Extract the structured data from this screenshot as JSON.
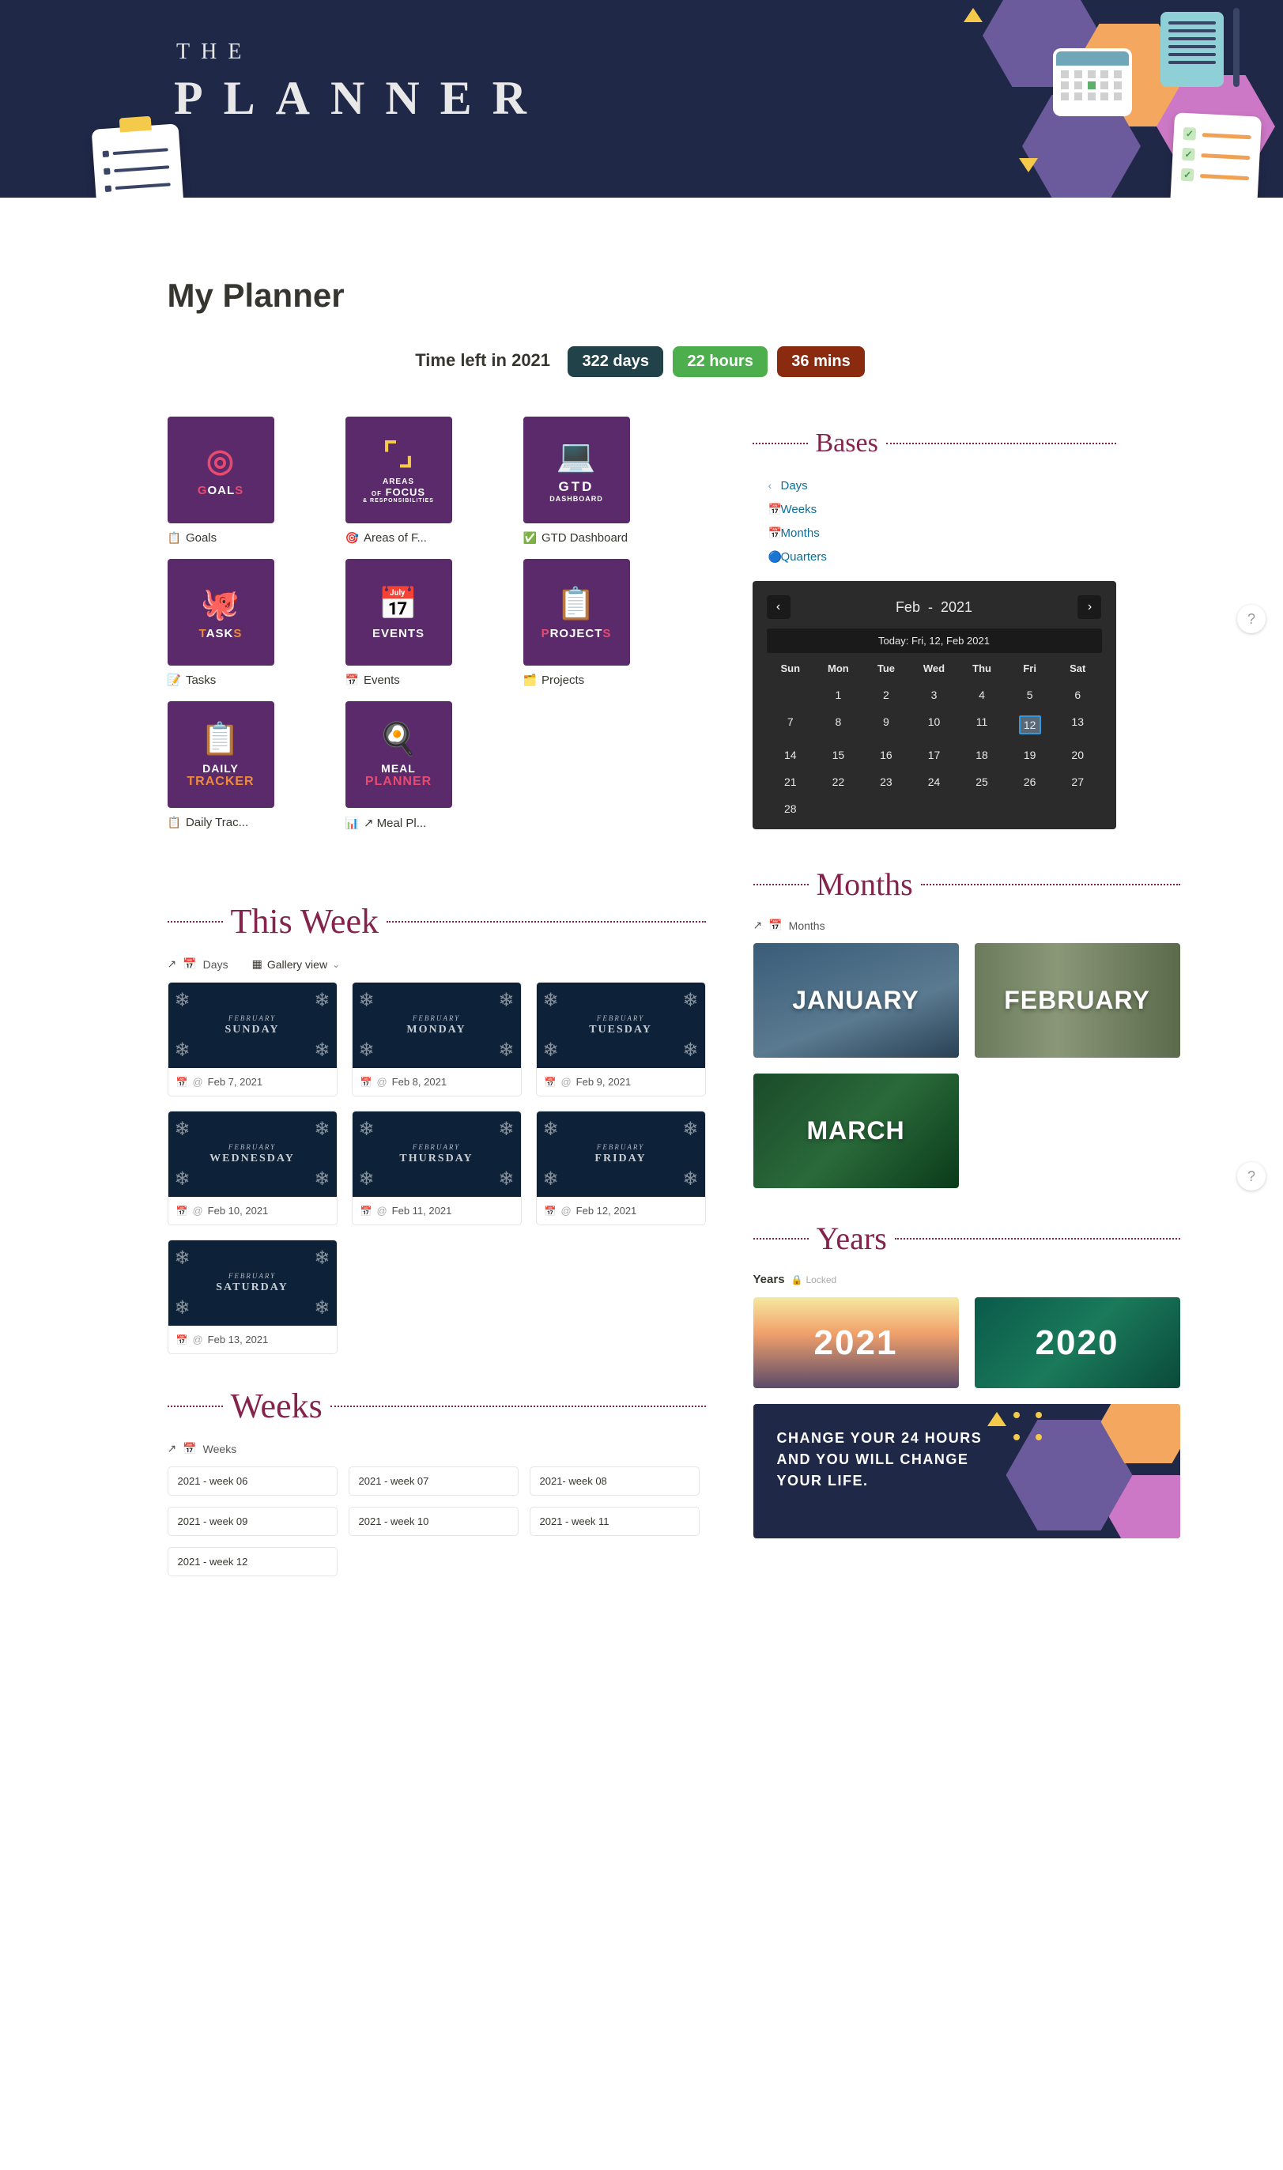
{
  "hero": {
    "line1": "THE",
    "line2": "PLANNER"
  },
  "page_title": "My Planner",
  "countdown": {
    "label": "Time left in 2021",
    "days": "322 days",
    "hours": "22 hours",
    "mins": "36 mins"
  },
  "tiles": [
    {
      "title": "GOALS",
      "icon": "target",
      "label": "Goals",
      "emoji": "📋"
    },
    {
      "title": "AREAS OF FOCUS",
      "sub": "& RESPONSIBILITIES",
      "icon": "focus",
      "label": "Areas of F...",
      "emoji": "🎯"
    },
    {
      "title": "GTD DASHBOARD",
      "icon": "gtd",
      "label": "GTD Dashboard",
      "emoji": "✅"
    },
    {
      "title": "TASKS",
      "icon": "tasks",
      "label": "Tasks",
      "emoji": "📝"
    },
    {
      "title": "EVENTS",
      "icon": "events",
      "label": "Events",
      "emoji": "📅"
    },
    {
      "title": "PROJECTS",
      "icon": "projects",
      "label": "Projects",
      "emoji": "🗂️"
    },
    {
      "title": "DAILY TRACKER",
      "icon": "tracker",
      "label": "Daily Trac...",
      "emoji": "📋"
    },
    {
      "title": "MEAL PLANNER",
      "icon": "meal",
      "label": "↗ Meal Pl...",
      "emoji": "📊"
    }
  ],
  "bases": {
    "heading": "Bases",
    "items": [
      {
        "bullet_color": "#6aa0d8",
        "label": "Days",
        "href": "#days"
      },
      {
        "icon": "📅",
        "label": "Weeks",
        "href": "#weeks"
      },
      {
        "icon": "📅",
        "label": "Months",
        "href": "#months"
      },
      {
        "icon": "🔵",
        "label": "Quarters",
        "href": "#quarters"
      }
    ]
  },
  "calendar": {
    "month": "Feb",
    "year": "2021",
    "separator": "-",
    "today_text": "Today: Fri, 12, Feb 2021",
    "dow": [
      "Sun",
      "Mon",
      "Tue",
      "Wed",
      "Thu",
      "Fri",
      "Sat"
    ],
    "days": [
      [
        "",
        "1",
        "2",
        "3",
        "4",
        "5",
        "6"
      ],
      [
        "7",
        "8",
        "9",
        "10",
        "11",
        "12",
        "13"
      ],
      [
        "14",
        "15",
        "16",
        "17",
        "18",
        "19",
        "20"
      ],
      [
        "21",
        "22",
        "23",
        "24",
        "25",
        "26",
        "27"
      ],
      [
        "28",
        "",
        "",
        "",
        "",
        "",
        ""
      ]
    ],
    "today_day": "12"
  },
  "this_week": {
    "heading": "This Week",
    "crumb_label": "Days",
    "view_label": "Gallery view",
    "cards": [
      {
        "month": "FEBRUARY",
        "day": "SUNDAY",
        "date": "Feb 7, 2021"
      },
      {
        "month": "FEBRUARY",
        "day": "MONDAY",
        "date": "Feb 8, 2021"
      },
      {
        "month": "FEBRUARY",
        "day": "TUESDAY",
        "date": "Feb 9, 2021"
      },
      {
        "month": "FEBRUARY",
        "day": "WEDNESDAY",
        "date": "Feb 10, 2021"
      },
      {
        "month": "FEBRUARY",
        "day": "THURSDAY",
        "date": "Feb 11, 2021"
      },
      {
        "month": "FEBRUARY",
        "day": "FRIDAY",
        "date": "Feb 12, 2021"
      },
      {
        "month": "FEBRUARY",
        "day": "SATURDAY",
        "date": "Feb 13, 2021"
      }
    ]
  },
  "weeks": {
    "heading": "Weeks",
    "crumb_label": "Weeks",
    "items": [
      "2021 - week 06",
      "2021 - week 07",
      "2021- week 08",
      "2021 - week 09",
      "2021 - week 10",
      "2021 - week 11",
      "2021 - week 12"
    ]
  },
  "months": {
    "heading": "Months",
    "crumb_label": "Months",
    "items": [
      "JANUARY",
      "FEBRUARY",
      "MARCH"
    ]
  },
  "years": {
    "heading": "Years",
    "label": "Years",
    "locked": "Locked",
    "items": [
      "2021",
      "2020"
    ]
  },
  "quote": "CHANGE YOUR 24 HOURS AND YOU WILL CHANGE YOUR LIFE.",
  "help": "?"
}
